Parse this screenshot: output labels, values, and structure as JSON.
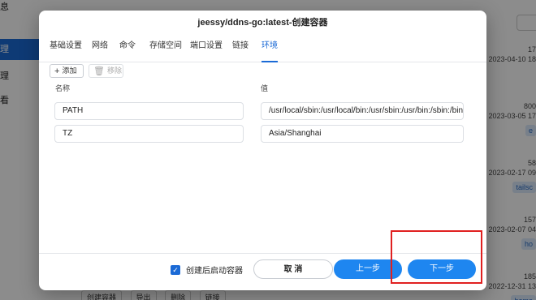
{
  "background": {
    "sidebar_items": [
      "息",
      "理",
      "理",
      "看"
    ],
    "right_rows": [
      {
        "num": "17",
        "date": "2023-04-10 18",
        "tag": ""
      },
      {
        "num": "800",
        "date": "2023-03-05 17",
        "tag": "e"
      },
      {
        "num": "58",
        "date": "2023-02-17 09",
        "tag": "tailsc"
      },
      {
        "num": "157",
        "date": "2023-02-07 04",
        "tag": "ho"
      },
      {
        "num": "185",
        "date": "2022-12-31 13",
        "tag": "home"
      }
    ],
    "bottom_buttons": [
      "创建容器",
      "导出",
      "删除",
      "链接"
    ]
  },
  "modal": {
    "title": "jeessy/ddns-go:latest-创建容器",
    "tabs": [
      "基础设置",
      "网络",
      "命令",
      "存储空间",
      "端口设置",
      "链接",
      "环境"
    ],
    "active_tab": "环境",
    "toolbar": {
      "add_label": "添加",
      "remove_label": "移除"
    },
    "columns": {
      "name": "名称",
      "value": "值"
    },
    "env_rows": [
      {
        "name": "PATH",
        "value": "/usr/local/sbin:/usr/local/bin:/usr/sbin:/usr/bin:/sbin:/bin"
      },
      {
        "name": "TZ",
        "value": "Asia/Shanghai"
      }
    ],
    "footer": {
      "checkbox_label": "创建后启动容器",
      "cancel_label": "取 消",
      "prev_label": "上一步",
      "next_label": "下一步"
    }
  },
  "colors": {
    "accent": "#1e86f0",
    "highlight": "#e02020"
  }
}
